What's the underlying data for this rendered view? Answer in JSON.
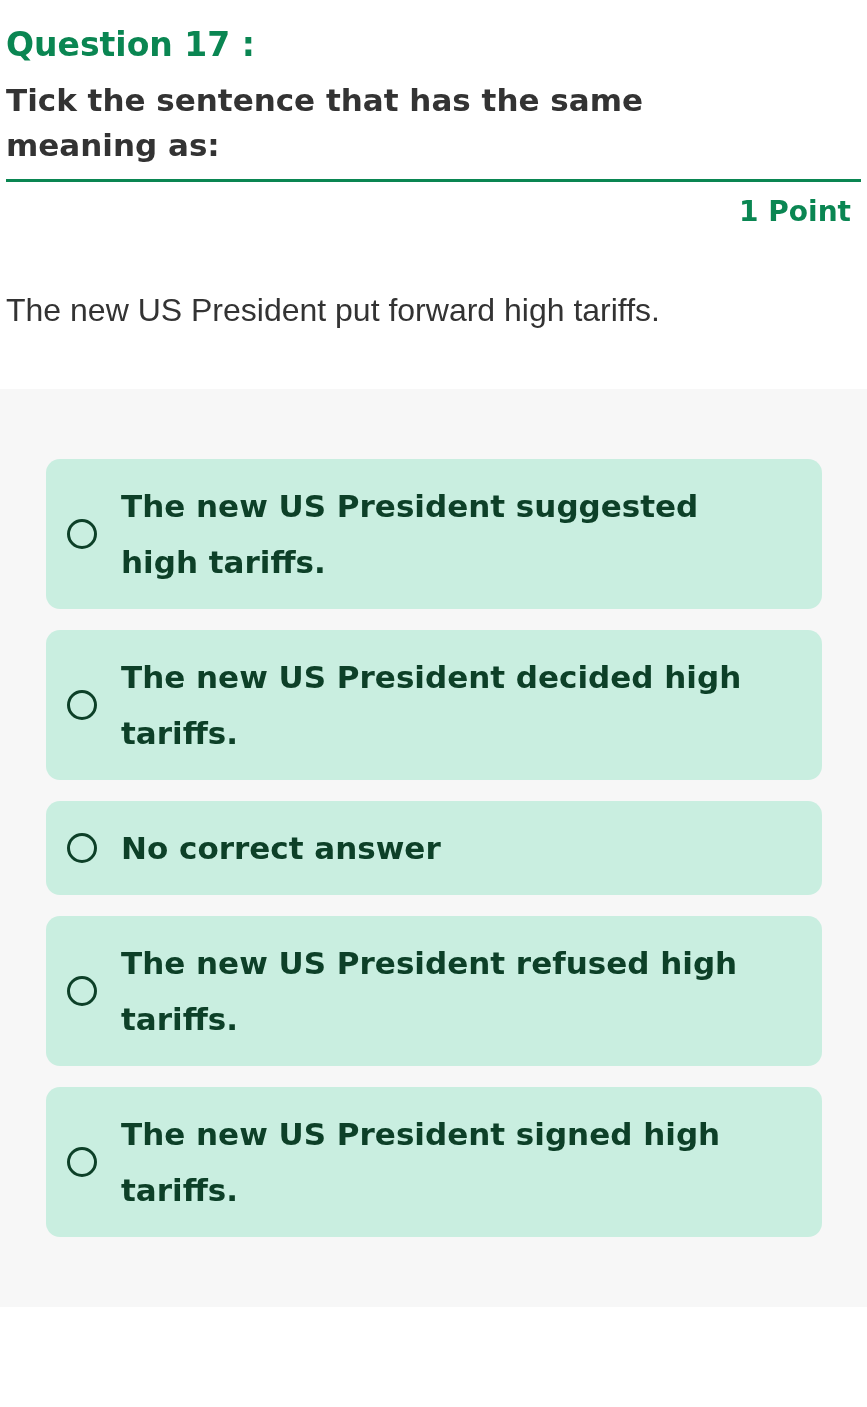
{
  "question": {
    "title": "Question 17 :",
    "instruction": "Tick the sentence that has the same meaning as:",
    "points": "1 Point",
    "sentence": "The new US President put forward high tariffs."
  },
  "options": [
    {
      "text": "The new US President suggested high tariffs.",
      "selected": false
    },
    {
      "text": "The new US President decided high tariffs.",
      "selected": false
    },
    {
      "text": "No correct answer",
      "selected": false
    },
    {
      "text": "The new US President refused high tariffs.",
      "selected": false
    },
    {
      "text": "The new US President signed high tariffs.",
      "selected": false
    }
  ]
}
